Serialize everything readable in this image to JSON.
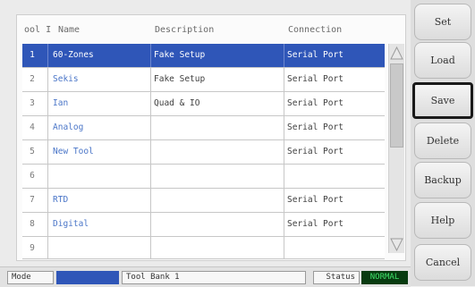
{
  "table": {
    "columns": {
      "id": "ool I",
      "name": "Name",
      "description": "Description",
      "connection": "Connection"
    },
    "rows": [
      {
        "id": "1",
        "name": "60-Zones",
        "description": "Fake Setup",
        "connection": "Serial Port",
        "selected": true
      },
      {
        "id": "2",
        "name": "Sekis",
        "description": "Fake Setup",
        "connection": "Serial Port"
      },
      {
        "id": "3",
        "name": "Ian",
        "description": "Quad & IO",
        "connection": "Serial Port"
      },
      {
        "id": "4",
        "name": "Analog",
        "description": "",
        "connection": "Serial Port"
      },
      {
        "id": "5",
        "name": "New Tool",
        "description": "",
        "connection": "Serial Port"
      },
      {
        "id": "6",
        "name": "",
        "description": "",
        "connection": ""
      },
      {
        "id": "7",
        "name": "RTD",
        "description": "",
        "connection": "Serial Port"
      },
      {
        "id": "8",
        "name": "Digital",
        "description": "",
        "connection": "Serial Port"
      },
      {
        "id": "9",
        "name": "",
        "description": "",
        "connection": ""
      }
    ]
  },
  "status_bar": {
    "mode_label": "Mode",
    "bank": "Tool Bank 1",
    "status_label": "Status",
    "status_value": "NORMAL"
  },
  "buttons": {
    "set": "Set",
    "load": "Load",
    "save": "Save",
    "delete": "Delete",
    "backup": "Backup",
    "help": "Help",
    "cancel": "Cancel"
  },
  "colors": {
    "selected_row": "#2f56b8",
    "name_text": "#4b76c8",
    "status_normal_bg": "#083b10",
    "status_normal_text": "#3fe06a"
  }
}
